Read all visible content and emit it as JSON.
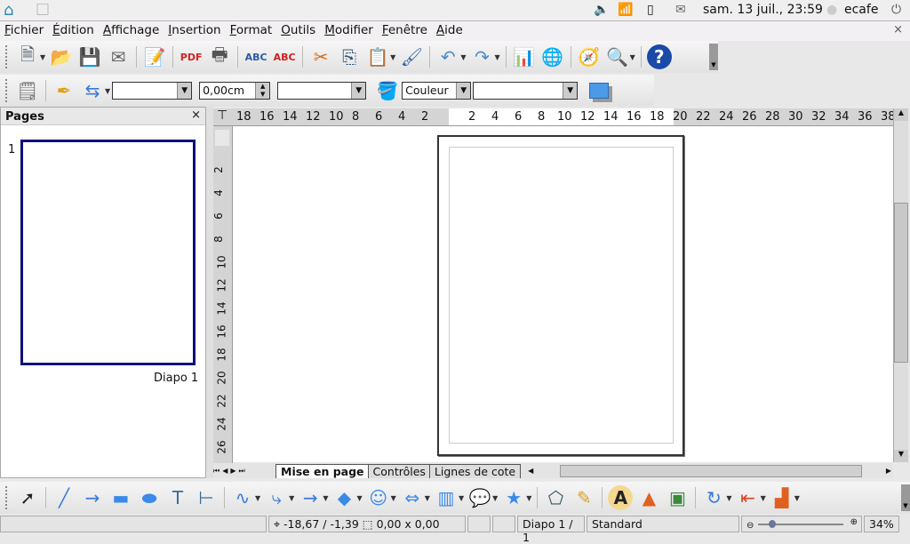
{
  "topbar": {
    "clock": "sam. 13 juil., 23:59",
    "user": "ecafe",
    "icons": [
      "eduke-home-icon",
      "app-icon",
      "volume-icon",
      "wifi-icon",
      "battery-icon",
      "mail-icon",
      "chat-icon",
      "power-icon"
    ]
  },
  "menubar": {
    "items": [
      "Fichier",
      "Édition",
      "Affichage",
      "Insertion",
      "Format",
      "Outils",
      "Modifier",
      "Fenêtre",
      "Aide"
    ],
    "close": "×"
  },
  "toolbar1": [
    {
      "n": "new-icon",
      "g": "🗎",
      "c": "#456",
      "d": 1
    },
    {
      "n": "open-icon",
      "g": "📂",
      "c": "#e8a020"
    },
    {
      "n": "save-icon",
      "g": "💾",
      "c": "#2a5a8a"
    },
    {
      "n": "email-icon",
      "g": "✉",
      "c": "#666"
    },
    {
      "sep": 1
    },
    {
      "n": "edit-file-icon",
      "g": "📝",
      "c": "#357"
    },
    {
      "sep": 1
    },
    {
      "n": "export-pdf-icon",
      "g": "PDF",
      "c": "#d22"
    },
    {
      "n": "print-icon",
      "g": "🖶",
      "c": "#555"
    },
    {
      "sep": 1
    },
    {
      "n": "spellcheck-icon",
      "g": "ABC",
      "c": "#2a5aa0"
    },
    {
      "n": "autospell-icon",
      "g": "ABC",
      "c": "#c22"
    },
    {
      "sep": 1
    },
    {
      "n": "cut-icon",
      "g": "✂",
      "c": "#d07020"
    },
    {
      "n": "copy-icon",
      "g": "⎘",
      "c": "#357"
    },
    {
      "n": "paste-icon",
      "g": "📋",
      "c": "#b08020",
      "d": 1
    },
    {
      "n": "format-paintbrush-icon",
      "g": "🖌",
      "c": "#36a"
    },
    {
      "sep": 1
    },
    {
      "n": "undo-icon",
      "g": "↶",
      "c": "#4a8ac8",
      "d": 1
    },
    {
      "n": "redo-icon",
      "g": "↷",
      "c": "#4a8ac8",
      "d": 1
    },
    {
      "sep": 1
    },
    {
      "n": "chart-icon",
      "g": "📊",
      "c": "#e44"
    },
    {
      "n": "hyperlink-icon",
      "g": "🌐",
      "c": "#3a8a3a"
    },
    {
      "sep": 1
    },
    {
      "n": "navigator-icon",
      "g": "🧭",
      "c": "#d33"
    },
    {
      "n": "zoom-icon",
      "g": "🔍",
      "c": "#4a8ac8",
      "d": 1
    },
    {
      "sep": 1
    },
    {
      "n": "help-icon",
      "g": "?",
      "c": "#fff",
      "bg": "#1a4aa8"
    }
  ],
  "toolbar2": {
    "line_width": "0,00cm",
    "area_style": "Couleur",
    "icons": [
      "line-style-icon",
      "line-icon",
      "arrow-style-icon",
      "area-icon",
      "shadow-icon"
    ]
  },
  "pages_pane": {
    "title": "Pages",
    "close": "×",
    "slide_number": "1",
    "slide_name": "Diapo 1"
  },
  "hruler": {
    "left": [
      "18",
      "16",
      "14",
      "12",
      "10",
      "8",
      "6",
      "4",
      "2"
    ],
    "right": [
      "2",
      "4",
      "6",
      "8",
      "10",
      "12",
      "14",
      "16",
      "18",
      "20",
      "22",
      "24",
      "26",
      "28",
      "30",
      "32",
      "34",
      "36",
      "38"
    ]
  },
  "vruler": [
    "2",
    "4",
    "6",
    "8",
    "10",
    "12",
    "14",
    "16",
    "18",
    "20",
    "22",
    "24",
    "26"
  ],
  "tabs": [
    "Mise en page",
    "Contrôles",
    "Lignes de cote"
  ],
  "drawing_toolbar": [
    {
      "n": "select-icon",
      "g": "➚",
      "c": "#222"
    },
    {
      "sep": 1
    },
    {
      "n": "line-tool-icon",
      "g": "╱",
      "c": "#3a7ad8"
    },
    {
      "n": "arrow-line-icon",
      "g": "→",
      "c": "#3a7ad8"
    },
    {
      "n": "rectangle-icon",
      "g": "▬",
      "c": "#3a8ae8"
    },
    {
      "n": "ellipse-icon",
      "g": "⬬",
      "c": "#3a8ae8"
    },
    {
      "n": "text-icon",
      "g": "T",
      "c": "#3a6a9a"
    },
    {
      "n": "vertical-text-icon",
      "g": "⊢",
      "c": "#3a6a9a"
    },
    {
      "sep": 1
    },
    {
      "n": "curve-icon",
      "g": "∿",
      "c": "#3a7ad8",
      "d": 1
    },
    {
      "n": "connector-icon",
      "g": "⤷",
      "c": "#3a7ad8",
      "d": 1
    },
    {
      "n": "lines-arrows-icon",
      "g": "→",
      "c": "#3a7ad8",
      "d": 1
    },
    {
      "n": "basic-shapes-icon",
      "g": "◆",
      "c": "#3a8ae8",
      "d": 1
    },
    {
      "n": "symbol-shapes-icon",
      "g": "☺",
      "c": "#3a8ae8",
      "d": 1
    },
    {
      "n": "block-arrows-icon",
      "g": "⇔",
      "c": "#3a8ae8",
      "d": 1
    },
    {
      "n": "flowchart-icon",
      "g": "▥",
      "c": "#3a8ae8",
      "d": 1
    },
    {
      "n": "callouts-icon",
      "g": "💬",
      "c": "#3a8ae8",
      "d": 1
    },
    {
      "n": "stars-icon",
      "g": "★",
      "c": "#3a8ae8",
      "d": 1
    },
    {
      "sep": 1
    },
    {
      "n": "points-icon",
      "g": "⬠",
      "c": "#356"
    },
    {
      "n": "glue-points-icon",
      "g": "✎",
      "c": "#d9a020"
    },
    {
      "sep": 1
    },
    {
      "n": "fontwork-icon",
      "g": "A",
      "c": "#222",
      "bg": "#f4d890"
    },
    {
      "n": "from-file-icon",
      "g": "▲",
      "c": "#e06020"
    },
    {
      "n": "gallery-icon",
      "g": "▣",
      "c": "#3a8a3a"
    },
    {
      "sep": 1
    },
    {
      "n": "rotate-icon",
      "g": "↻",
      "c": "#3a7ad8",
      "d": 1
    },
    {
      "n": "alignment-icon",
      "g": "⇤",
      "c": "#e04020",
      "d": 1
    },
    {
      "n": "arrange-icon",
      "g": "▟",
      "c": "#e06020",
      "d": 1
    }
  ],
  "statusbar": {
    "position": "-18,67 / -1,39",
    "size": "0,00 x 0,00",
    "slide": "Diapo 1 / 1",
    "layout": "Standard",
    "zoom_percent": "34%",
    "zoom_level": 34
  }
}
